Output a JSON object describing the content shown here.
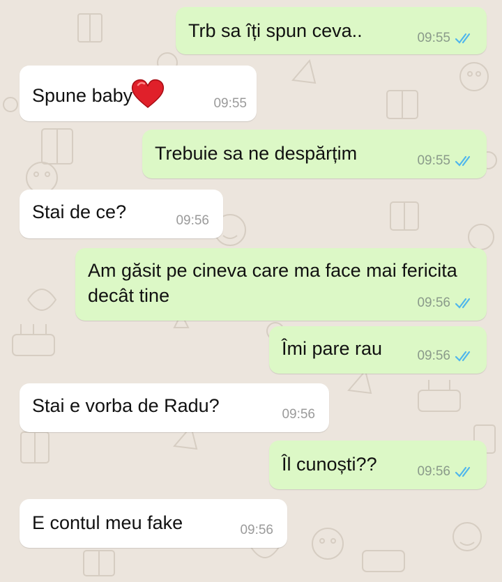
{
  "chat": {
    "messages": [
      {
        "text": "Trb sa îți spun ceva..",
        "time": "09:55"
      },
      {
        "text": "Spune baby",
        "emoji": "heart",
        "time": "09:55"
      },
      {
        "text": "Trebuie sa ne despărțim",
        "time": "09:55"
      },
      {
        "text": "Stai de ce?",
        "time": "09:56"
      },
      {
        "text": "Am găsit pe cineva care ma face mai fericita decât tine",
        "time": "09:56"
      },
      {
        "text": "Îmi pare rau",
        "time": "09:56"
      },
      {
        "text": "Stai e vorba de Radu?",
        "time": "09:56"
      },
      {
        "text": "Îl cunoști??",
        "time": "09:56"
      },
      {
        "text": "E contul meu fake",
        "time": "09:56"
      }
    ]
  },
  "colors": {
    "outgoing_bubble": "#dcf8c6",
    "incoming_bubble": "#ffffff",
    "background": "#ece5dd",
    "read_ticks": "#4fb6ec"
  },
  "icons": {
    "read_receipt": "double-check-icon",
    "emoji": "red-heart-icon"
  }
}
